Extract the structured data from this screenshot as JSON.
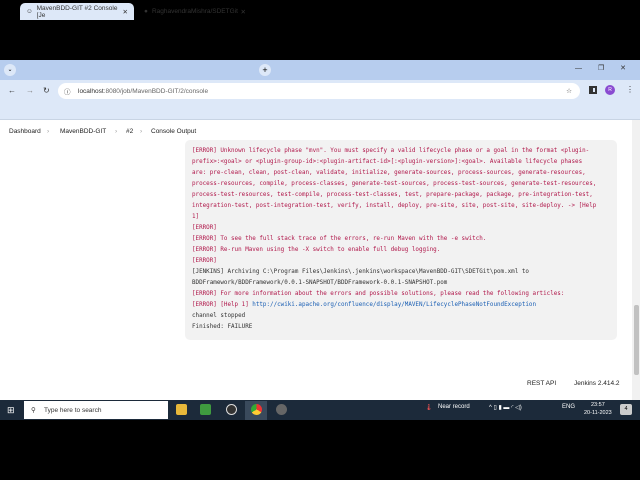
{
  "browser": {
    "tabs": [
      {
        "title": "MavenBDD-GIT #2 Console [Je"
      },
      {
        "title": "RaghavendraMishra/SDETGit"
      }
    ],
    "url_host": "localhost",
    "url_path": ":8080/job/MavenBDD-GIT/2/console",
    "profile_initial": "R"
  },
  "breadcrumb": [
    "Dashboard",
    "MavenBDD-GIT",
    "#2",
    "Console Output"
  ],
  "console": [
    {
      "t": "[ERROR] Unknown lifecycle phase \"mvn\". You must specify a valid lifecycle phase or a goal in the format <plugin-",
      "c": "err"
    },
    {
      "t": "prefix>:<goal> or <plugin-group-id>:<plugin-artifact-id>[:<plugin-version>]:<goal>. Available lifecycle phases",
      "c": "err"
    },
    {
      "t": "are: pre-clean, clean, post-clean, validate, initialize, generate-sources, process-sources, generate-resources,",
      "c": "err"
    },
    {
      "t": "process-resources, compile, process-classes, generate-test-sources, process-test-sources, generate-test-resources,",
      "c": "err"
    },
    {
      "t": "process-test-resources, test-compile, process-test-classes, test, prepare-package, package, pre-integration-test,",
      "c": "err"
    },
    {
      "t": "integration-test, post-integration-test, verify, install, deploy, pre-site, site, post-site, site-deploy. -> [Help",
      "c": "err"
    },
    {
      "t": "1]",
      "c": "err"
    },
    {
      "t": "[ERROR]",
      "c": "err"
    },
    {
      "t": "[ERROR] To see the full stack trace of the errors, re-run Maven with the -e switch.",
      "c": "err"
    },
    {
      "t": "[ERROR] Re-run Maven using the -X switch to enable full debug logging.",
      "c": "err"
    },
    {
      "t": "[ERROR]",
      "c": "err"
    },
    {
      "t": "[JENKINS] Archiving C:\\Program Files\\Jenkins\\.jenkins\\workspace\\MavenBDD-GIT\\SDETGit\\pom.xml to",
      "c": ""
    },
    {
      "t": "BDDFramework/BDDFramework/0.0.1-SNAPSHOT/BDDFramework-0.0.1-SNAPSHOT.pom",
      "c": ""
    },
    {
      "t": "[ERROR] For more information about the errors and possible solutions, please read the following articles:",
      "c": "err"
    },
    {
      "t": "channel stopped",
      "c": ""
    },
    {
      "t": "Finished: FAILURE",
      "c": ""
    }
  ],
  "help_line": {
    "prefix": "[ERROR] [Help 1] ",
    "link": "http://cwiki.apache.org/confluence/display/MAVEN/LifecyclePhaseNotFoundException"
  },
  "footer": {
    "rest_api": "REST API",
    "version": "Jenkins 2.414.2"
  },
  "taskbar": {
    "search_placeholder": "Type here to search",
    "weather": "Near record",
    "lang": "ENG",
    "time": "23:57",
    "date": "20-11-2023",
    "notifications": "4"
  }
}
